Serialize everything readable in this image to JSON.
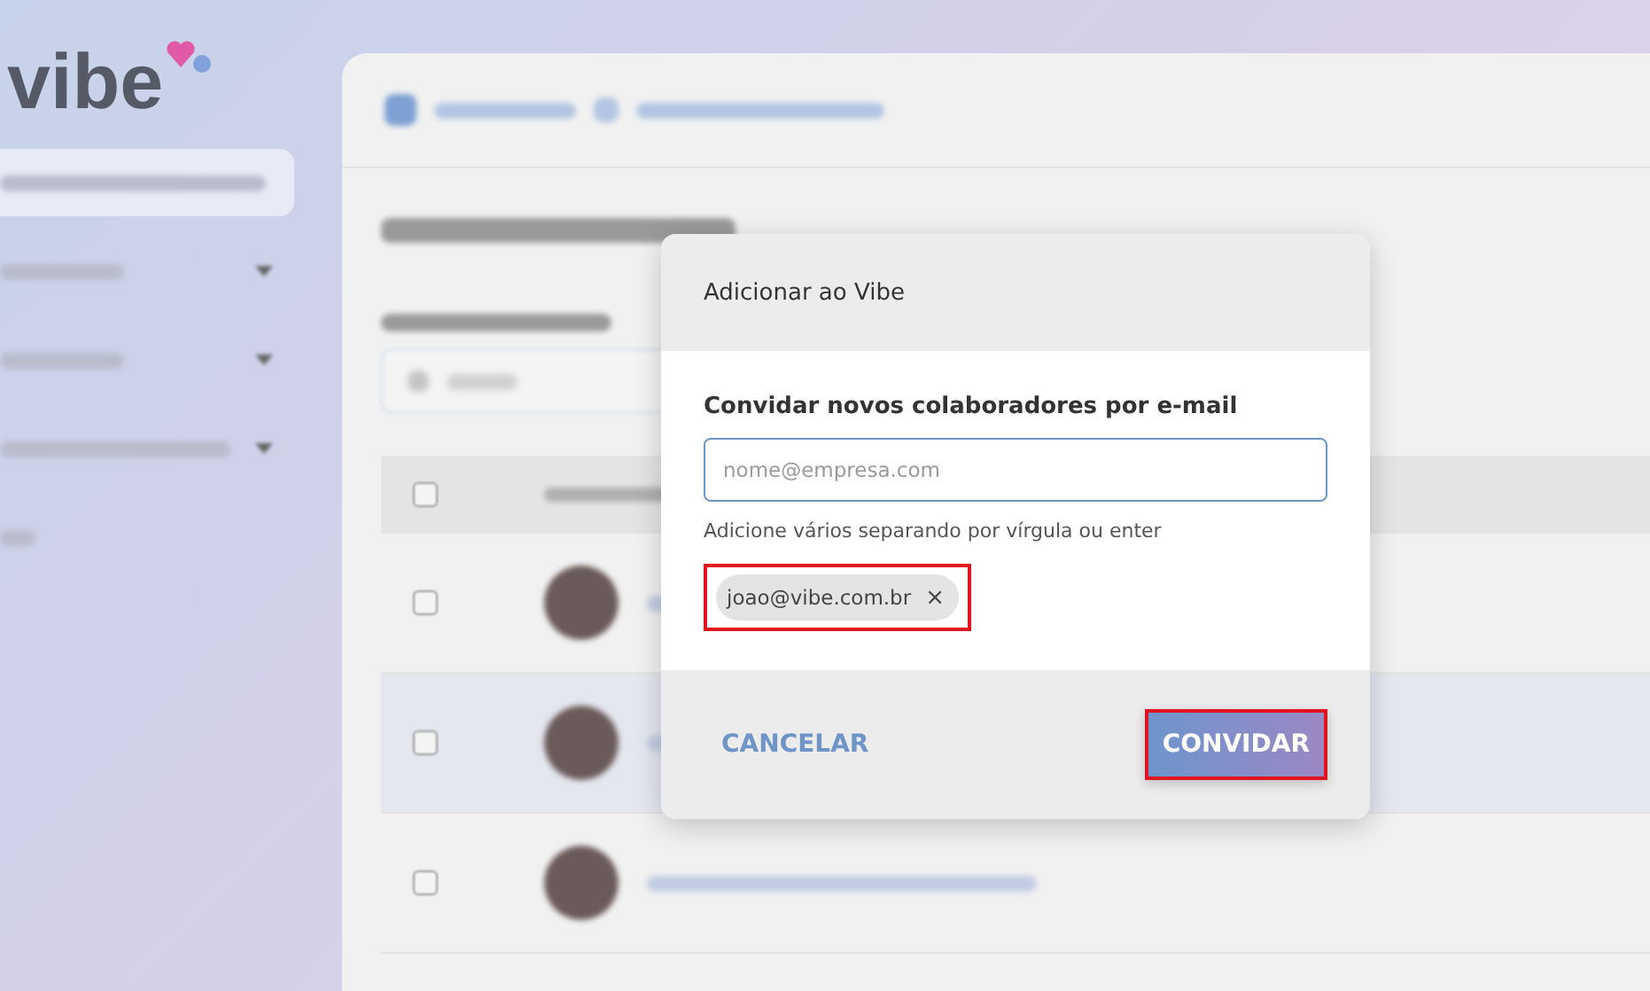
{
  "sidebar": {
    "logo": "vibe",
    "items": [
      {
        "selected": true,
        "expandable": false
      },
      {
        "selected": false,
        "expandable": true
      },
      {
        "selected": false,
        "expandable": true
      },
      {
        "selected": false,
        "expandable": true
      },
      {
        "selected": false,
        "expandable": false
      }
    ]
  },
  "page": {
    "header_checked": false,
    "rows": [
      {
        "selected": false,
        "highlighted": false
      },
      {
        "selected": false,
        "highlighted": true
      },
      {
        "selected": false,
        "highlighted": false
      }
    ]
  },
  "dialog": {
    "title": "Adicionar ao Vibe",
    "label": "Convidar novos colaboradores por e-mail",
    "placeholder": "nome@empresa.com",
    "hint": "Adicione vários separando por vírgula ou enter",
    "chips": [
      {
        "label": "joao@vibe.com.br",
        "remove": "×",
        "marked": true
      }
    ],
    "cancel": "CANCELAR",
    "confirm": "CONVIDAR",
    "confirm_marked": true
  }
}
